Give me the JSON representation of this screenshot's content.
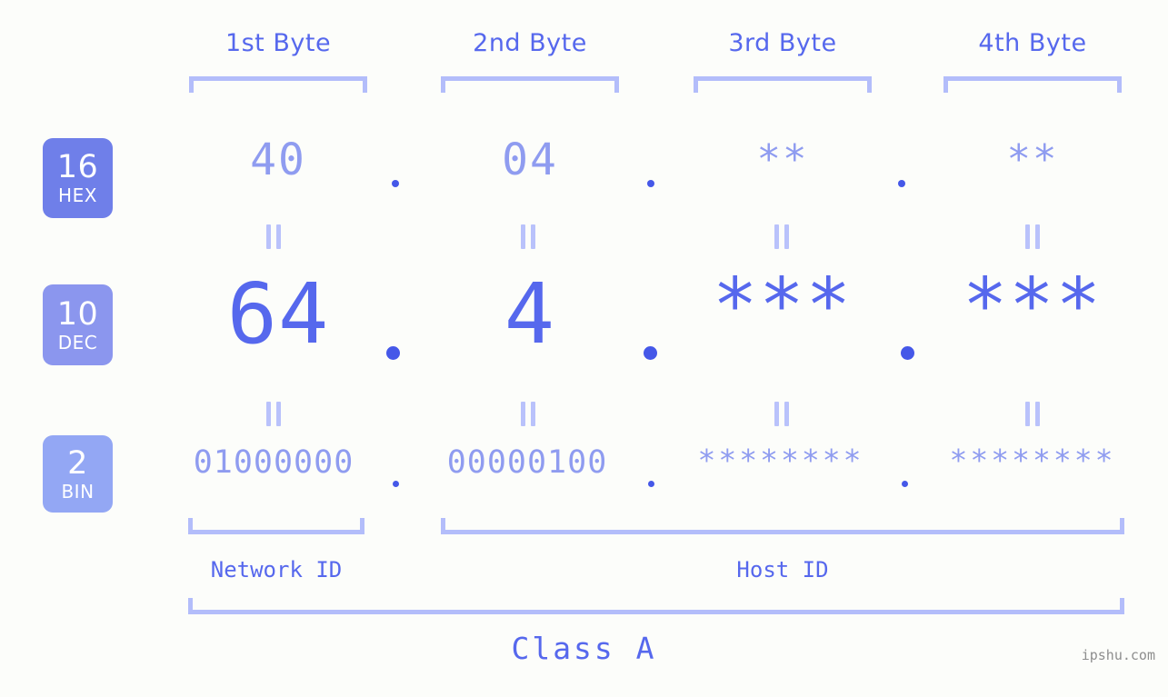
{
  "background_color": "#fcfdfa",
  "accent_color": "#5668ed",
  "muted_accent_color": "#8f9cf0",
  "bracket_color": "#b3bdfa",
  "byte_headers": [
    {
      "label": "1st Byte"
    },
    {
      "label": "2nd Byte"
    },
    {
      "label": "3rd Byte"
    },
    {
      "label": "4th Byte"
    }
  ],
  "bases": [
    {
      "number": "16",
      "name": "HEX",
      "color": "#6f7fe9"
    },
    {
      "number": "10",
      "name": "DEC",
      "color": "#8b96ee"
    },
    {
      "number": "2",
      "name": "BIN",
      "color": "#93a7f4"
    }
  ],
  "rows": {
    "hex": {
      "base_number": "16",
      "base_name": "HEX",
      "values": [
        "40",
        "04",
        "**",
        "**"
      ],
      "separator": "."
    },
    "dec": {
      "base_number": "10",
      "base_name": "DEC",
      "values": [
        "64",
        "4",
        "***",
        "***"
      ],
      "separator": "."
    },
    "bin": {
      "base_number": "2",
      "base_name": "BIN",
      "values": [
        "01000000",
        "00000100",
        "********",
        "********"
      ],
      "separator": "."
    }
  },
  "equals_glyph": "||",
  "sections": [
    {
      "label": "Network ID"
    },
    {
      "label": "Host ID"
    }
  ],
  "class_label": "Class A",
  "watermark": "ipshu.com"
}
